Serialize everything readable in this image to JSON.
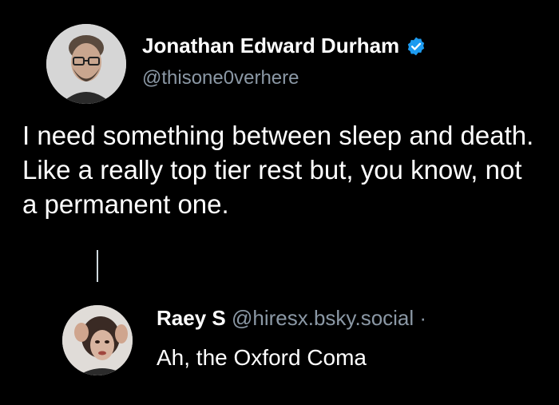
{
  "post": {
    "author_name": "Jonathan Edward Durham",
    "handle": "@thisone0verhere",
    "text": "I need something between sleep and death. Like a really top tier rest but, you know, not a permanent one.",
    "verified_icon": "verified-badge-icon",
    "accent_color": "#1d9bf0"
  },
  "reply": {
    "author_name": "Raey S",
    "handle": "@hiresx.bsky.social ·",
    "text": "Ah, the Oxford Coma"
  },
  "colors": {
    "background": "#000000",
    "primary_text": "#ffffff",
    "secondary_text": "#8b98a5"
  }
}
